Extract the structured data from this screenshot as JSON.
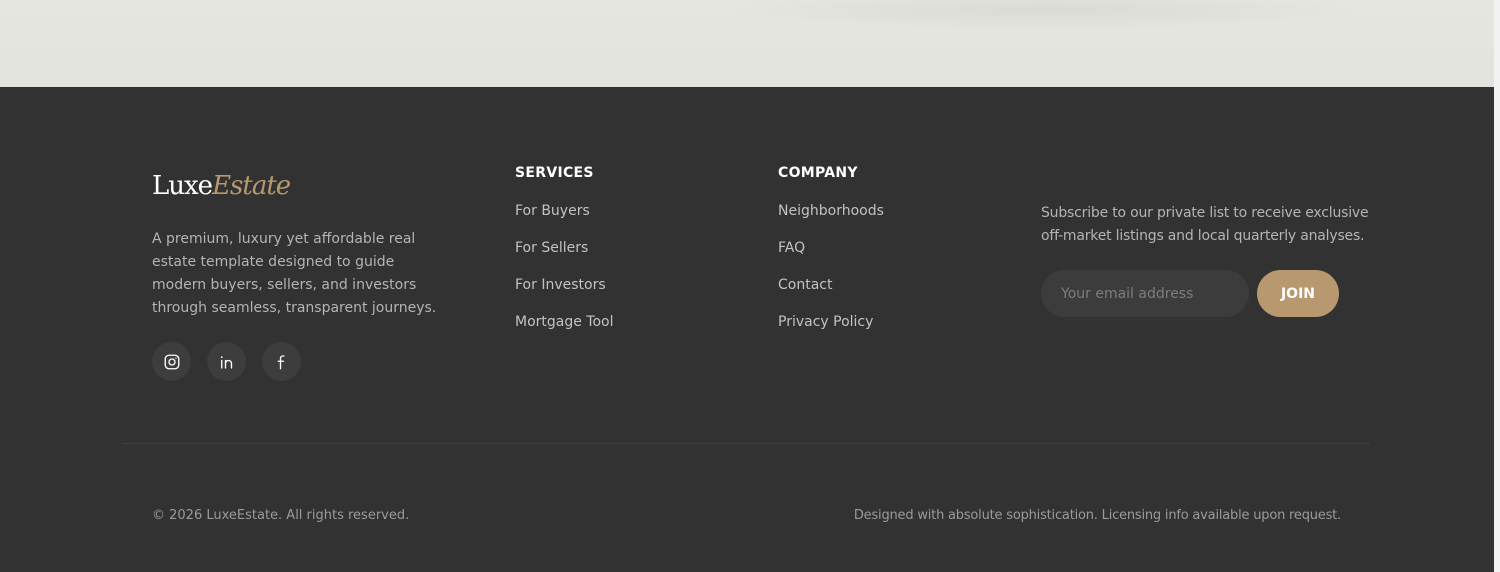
{
  "brand": {
    "name_main": "Luxe",
    "name_accent": "Estate",
    "accent_color": "#b8986f"
  },
  "about": {
    "description": "A premium, luxury yet affordable real estate template designed to guide modern buyers, sellers, and investors through seamless, transparent journeys."
  },
  "socials": [
    {
      "icon": "instagram-icon"
    },
    {
      "icon": "linkedin-icon"
    },
    {
      "icon": "facebook-icon"
    }
  ],
  "services": {
    "heading": "SERVICES",
    "links": [
      "For Buyers",
      "For Sellers",
      "For Investors",
      "Mortgage Tool"
    ]
  },
  "company": {
    "heading": "COMPANY",
    "links": [
      "Neighborhoods",
      "FAQ",
      "Contact",
      "Privacy Policy"
    ]
  },
  "newsletter": {
    "line1": "Subscribe to our private list to receive exclusive",
    "line2": "off-market listings and local quarterly analyses.",
    "placeholder": "Your email address",
    "button_label": "JOIN"
  },
  "bottom": {
    "copyright": "© 2026 LuxeEstate. All rights reserved.",
    "credits": "Designed with absolute sophistication. Licensing info available upon request."
  },
  "colors": {
    "footer_bg": "#323232",
    "page_bg": "#e4e4df",
    "button_bg": "#b8986f"
  }
}
